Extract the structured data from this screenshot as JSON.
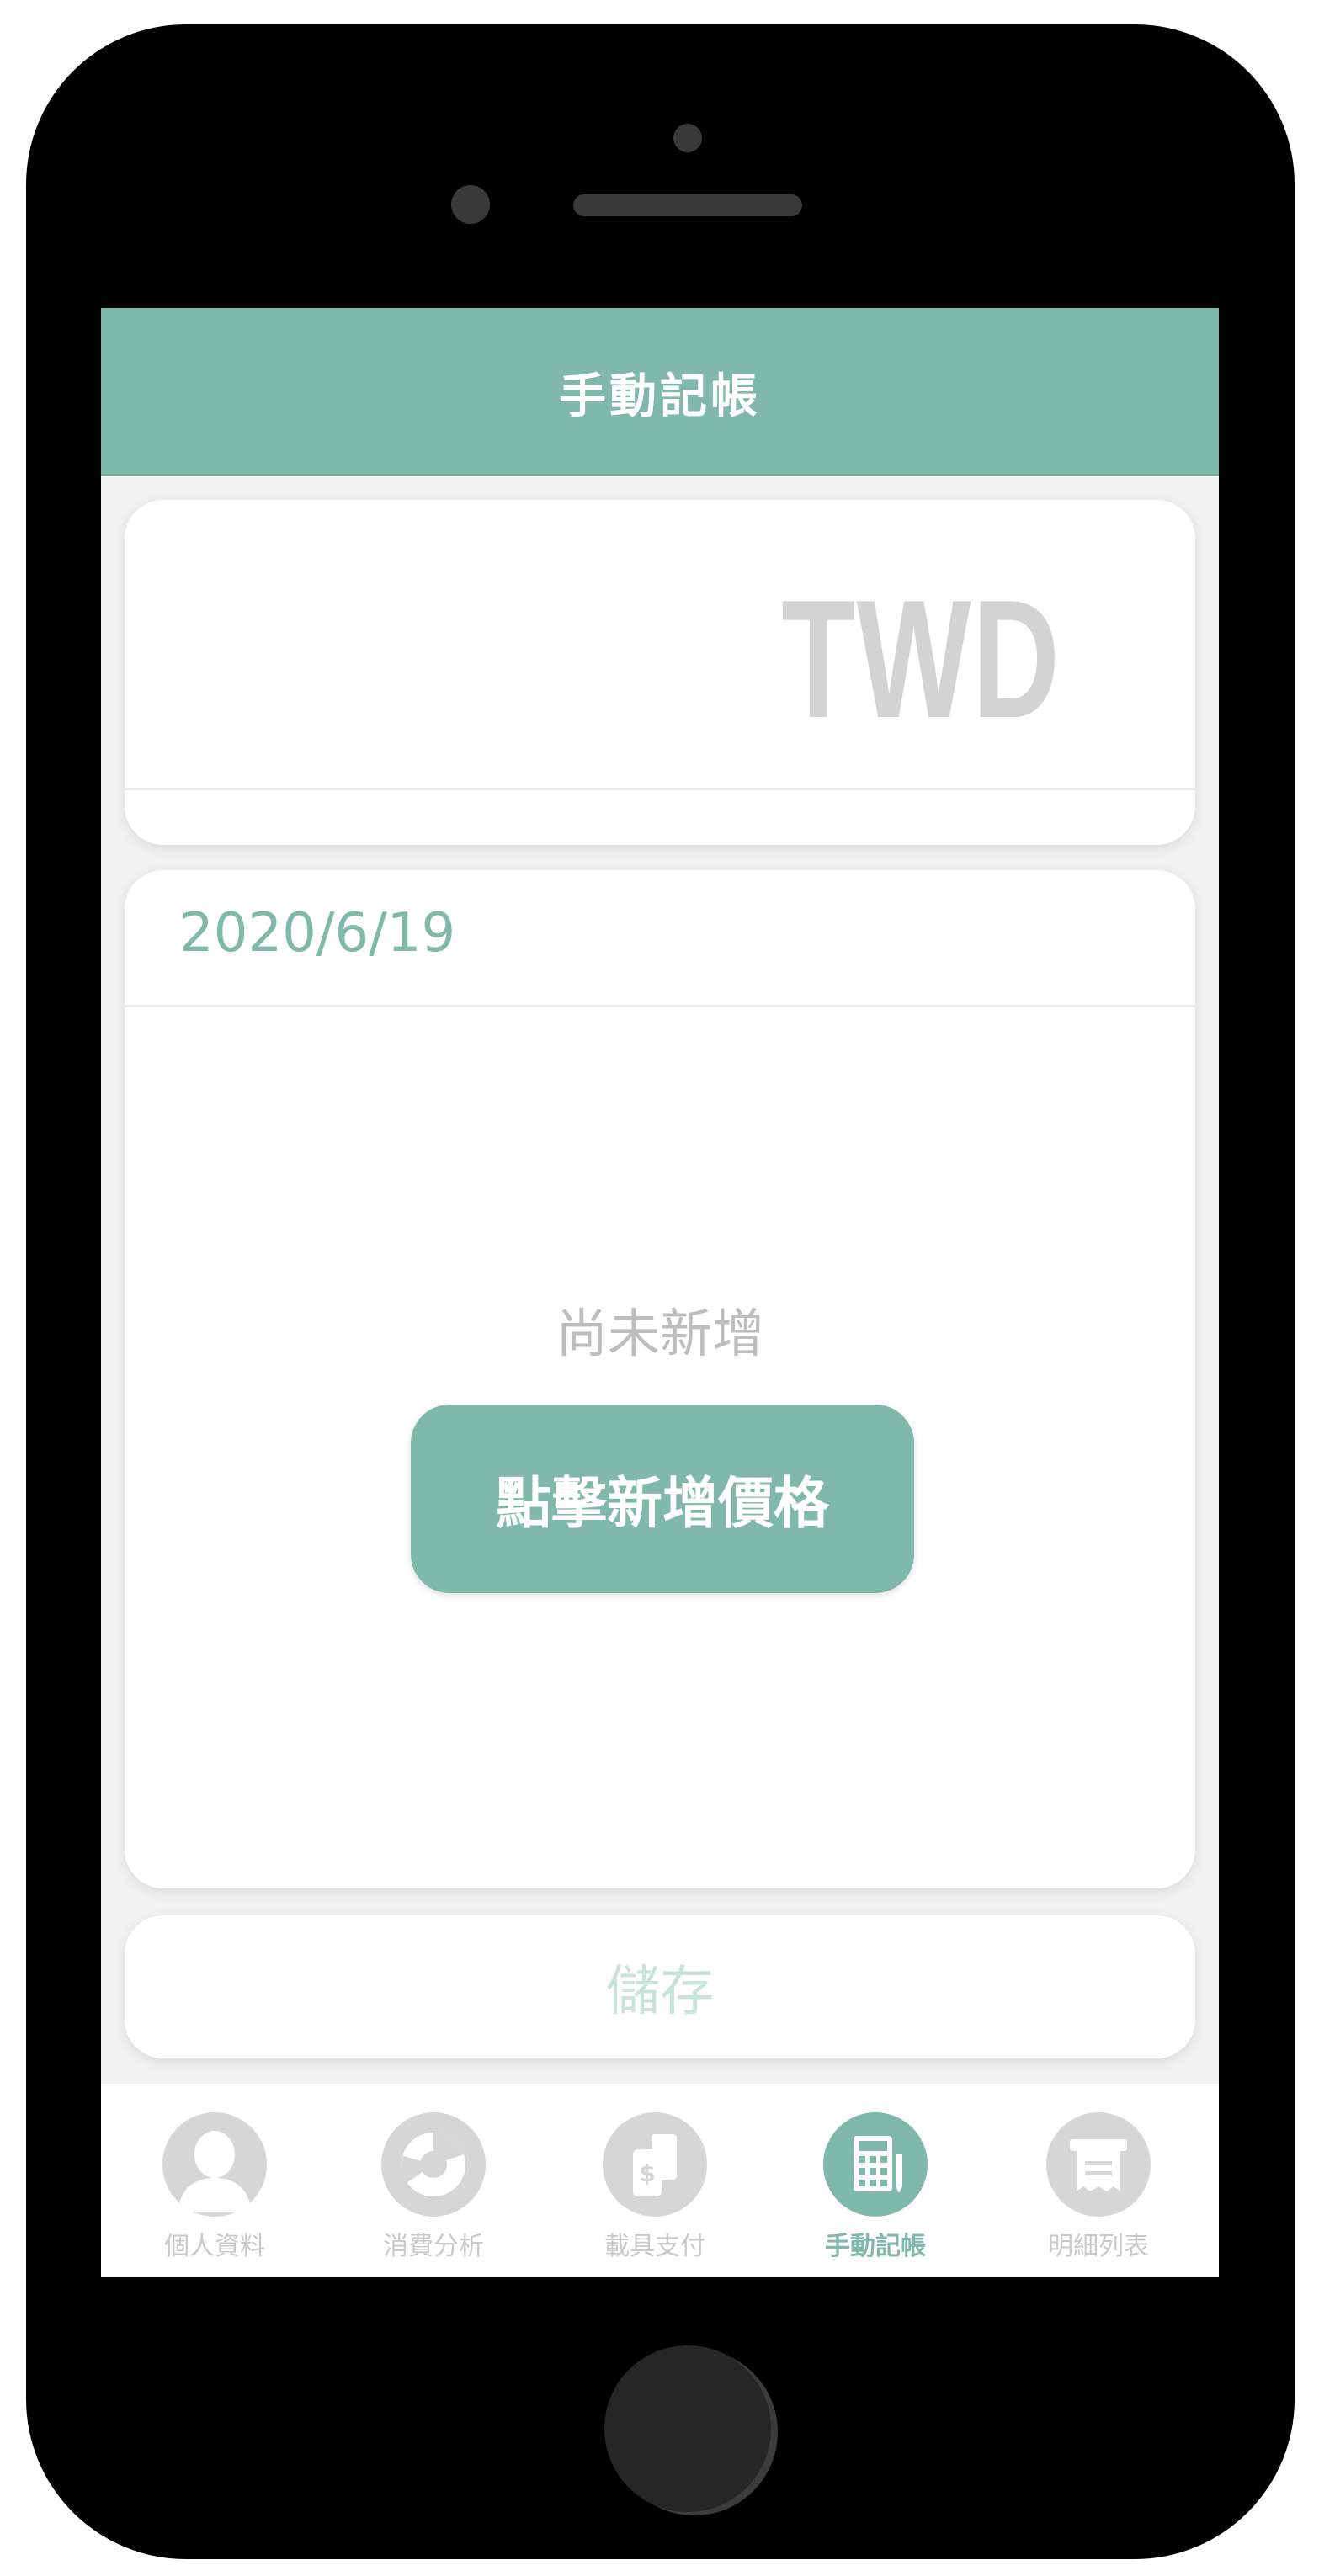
{
  "header": {
    "title": "手動記帳"
  },
  "amount": {
    "value": "",
    "currency": "TWD"
  },
  "detail": {
    "date": "2020/6/19",
    "empty_text": "尚未新增",
    "add_button_label": "點擊新增價格"
  },
  "save": {
    "label": "儲存"
  },
  "nav": {
    "items": [
      {
        "label": "個人資料",
        "icon": "profile-icon",
        "active": false
      },
      {
        "label": "消費分析",
        "icon": "pie-chart-icon",
        "active": false
      },
      {
        "label": "載具支付",
        "icon": "card-pay-icon",
        "active": false
      },
      {
        "label": "手動記帳",
        "icon": "calculator-icon",
        "active": true
      },
      {
        "label": "明細列表",
        "icon": "receipt-icon",
        "active": false
      }
    ]
  },
  "colors": {
    "accent": "#80b8aa",
    "inactive": "#d6d6d6"
  }
}
